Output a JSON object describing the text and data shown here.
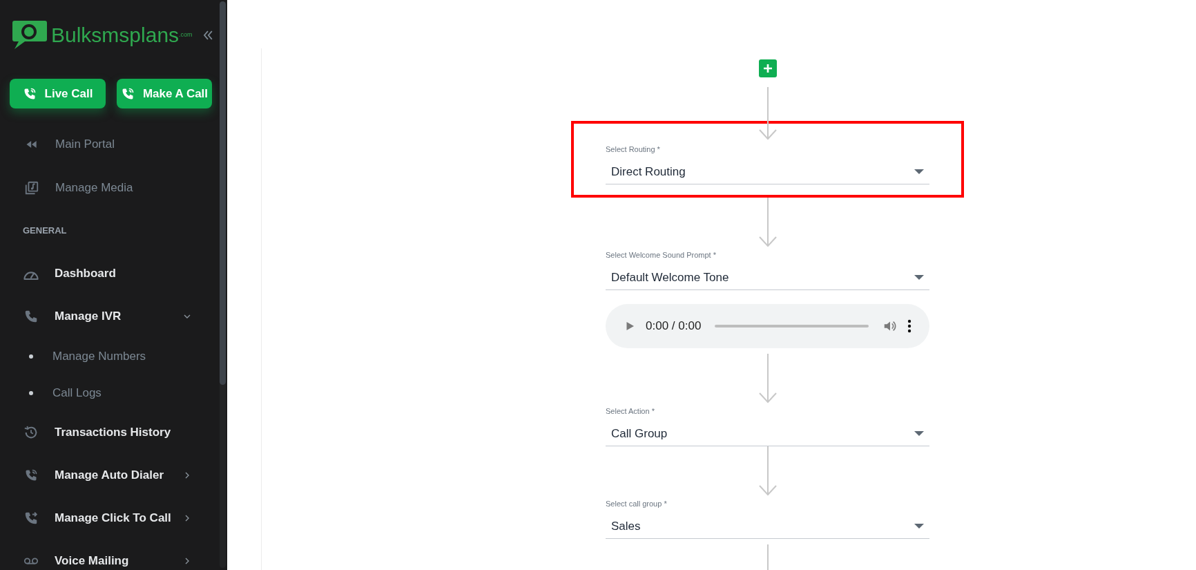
{
  "sidebar": {
    "logo": {
      "name": "Bulksmsplans",
      "suffix": ".com"
    },
    "buttons": [
      {
        "label": "Live Call"
      },
      {
        "label": "Make A Call"
      }
    ],
    "items": [
      {
        "kind": "link",
        "label": "Main Portal"
      },
      {
        "kind": "link",
        "label": "Manage Media"
      },
      {
        "kind": "section",
        "label": "GENERAL"
      },
      {
        "kind": "menu",
        "label": "Dashboard"
      },
      {
        "kind": "menu",
        "label": "Manage IVR",
        "expandable": true,
        "expanded": true
      },
      {
        "kind": "sub",
        "label": "Manage Numbers"
      },
      {
        "kind": "sub",
        "label": "Call Logs"
      },
      {
        "kind": "menu",
        "label": "Transactions History"
      },
      {
        "kind": "menu",
        "label": "Manage Auto Dialer",
        "expandable": true,
        "expanded": false
      },
      {
        "kind": "menu",
        "label": "Manage Click To Call",
        "expandable": true,
        "expanded": false
      },
      {
        "kind": "menu",
        "label": "Voice Mailing",
        "expandable": true,
        "expanded": false
      }
    ]
  },
  "flow": [
    {
      "kind": "select",
      "label": "Select Routing *",
      "value": "Direct Routing",
      "highlighted": true
    },
    {
      "kind": "select",
      "label": "Select Welcome Sound Prompt *",
      "value": "Default Welcome Tone",
      "highlighted": false
    },
    {
      "kind": "audio",
      "time": "0:00 / 0:00"
    },
    {
      "kind": "select",
      "label": "Select Action *",
      "value": "Call Group",
      "highlighted": false
    },
    {
      "kind": "select",
      "label": "Select call group *",
      "value": "Sales",
      "highlighted": false
    }
  ]
}
